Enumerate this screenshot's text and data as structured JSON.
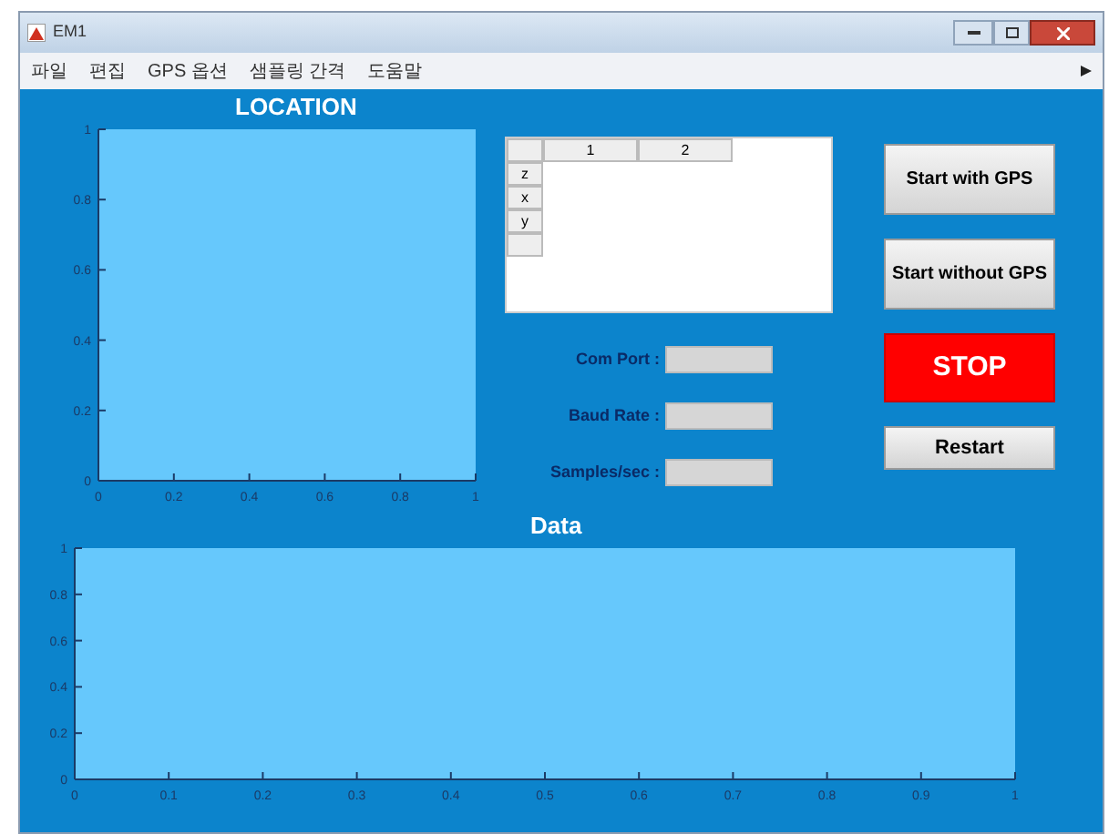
{
  "window": {
    "title": "EM1"
  },
  "menu": [
    "파일",
    "편집",
    "GPS 옵션",
    "샘플링 간격",
    "도움말"
  ],
  "location": {
    "title": "LOCATION",
    "chart_data": {
      "type": "line",
      "xlim": [
        0,
        1
      ],
      "ylim": [
        0,
        1
      ],
      "xticks": [
        0,
        0.2,
        0.4,
        0.6,
        0.8,
        1
      ],
      "yticks": [
        0,
        0.2,
        0.4,
        0.6,
        0.8,
        1
      ]
    }
  },
  "table": {
    "columns": [
      "1",
      "2"
    ],
    "rows": [
      "z",
      "x",
      "y",
      ""
    ]
  },
  "fields": [
    {
      "label": "Com Port :"
    },
    {
      "label": "Baud Rate :"
    },
    {
      "label": "Samples/sec :"
    }
  ],
  "buttons": [
    {
      "label": "Start with GPS",
      "kind": "normal"
    },
    {
      "label": "Start without GPS",
      "kind": "normal"
    },
    {
      "label": "STOP",
      "kind": "danger"
    },
    {
      "label": "Restart",
      "kind": "small"
    }
  ],
  "data": {
    "title": "Data",
    "chart_data": {
      "type": "line",
      "xlim": [
        0,
        1
      ],
      "ylim": [
        0,
        1
      ],
      "xticks": [
        0,
        0.1,
        0.2,
        0.3,
        0.4,
        0.5,
        0.6,
        0.7,
        0.8,
        0.9,
        1
      ],
      "yticks": [
        0,
        0.2,
        0.4,
        0.6,
        0.8,
        1
      ]
    }
  }
}
